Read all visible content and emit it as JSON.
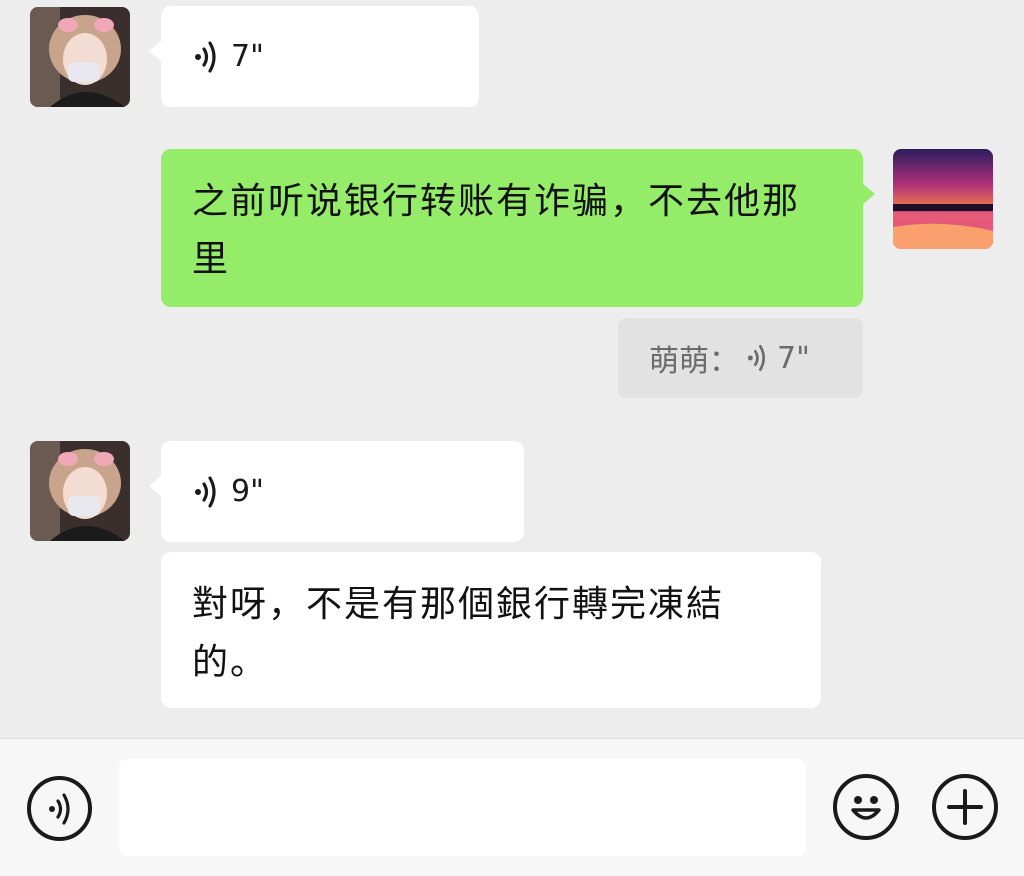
{
  "messages": [
    {
      "from": "contact",
      "type": "voice",
      "duration": "7\""
    },
    {
      "from": "me",
      "type": "text",
      "text": "之前听说银行转账有诈骗，不去他那里"
    },
    {
      "from": "me",
      "type": "quote",
      "quote_name": "萌萌：",
      "quote_duration": "7\""
    },
    {
      "from": "contact",
      "type": "voice",
      "duration": "9\""
    },
    {
      "from": "contact",
      "type": "text",
      "text": "對呀，不是有那個銀行轉完凍結的。"
    }
  ],
  "input": {
    "value": "",
    "placeholder": ""
  },
  "icons": {
    "voice_toggle": "voice-mode-icon",
    "emoji": "emoji-icon",
    "more": "plus-icon",
    "voice_wave": "voice-wave-icon"
  },
  "colors": {
    "background": "#ededed",
    "sent_bubble": "#95ec69",
    "received_bubble": "#ffffff",
    "quote_bg": "#e2e2e2"
  }
}
